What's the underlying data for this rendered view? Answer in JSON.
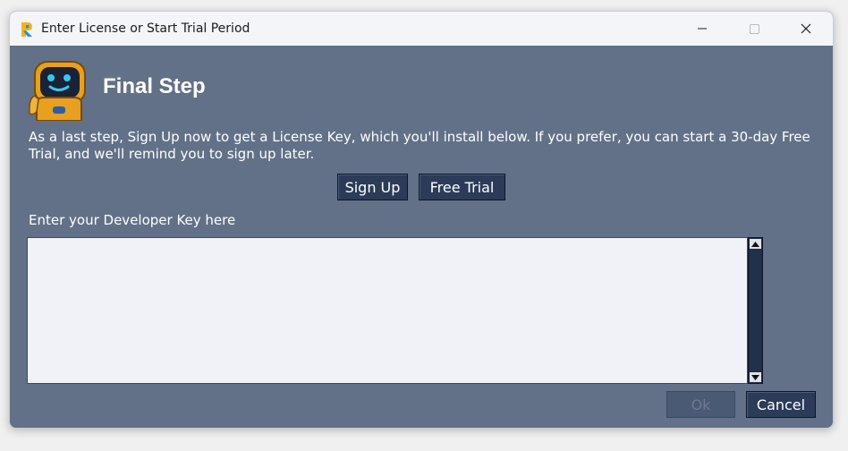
{
  "window": {
    "title": "Enter License or Start Trial Period",
    "app_icon": "ruby-logo-icon",
    "controls": {
      "minimize": "minimize-icon",
      "maximize": "maximize-icon",
      "close": "close-icon"
    }
  },
  "header": {
    "mascot_icon": "robot-mascot-icon",
    "title": "Final Step"
  },
  "body": {
    "description": "As a last step, Sign Up now to get a License Key, which you'll install below. If you prefer, you can start a 30-day Free Trial, and we'll remind you to sign up later.",
    "signup_label": "Sign Up",
    "trial_label": "Free Trial",
    "key_label": "Enter your Developer Key here",
    "key_value": ""
  },
  "footer": {
    "ok_label": "Ok",
    "cancel_label": "Cancel"
  },
  "colors": {
    "background": "#627188",
    "button": "#2b3b58",
    "text": "#ffffff",
    "input_bg": "#f0f2f7"
  }
}
